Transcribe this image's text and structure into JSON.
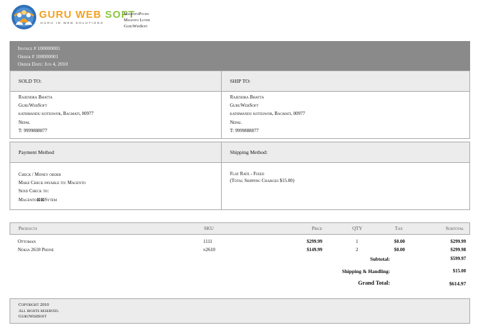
{
  "header": {
    "brand_part1": "GURU WEB",
    "brand_part2": " SOFT",
    "tagline": "GURU IN WEB SOLUTIONS",
    "store_lines": [
      "MagentoPycho",
      "Magento Lover",
      "GuruWebSoft"
    ]
  },
  "order": {
    "invoice": "Invoice # 100000001",
    "order": "Order # 100000001",
    "date": "Order Date: Jun 4, 2010"
  },
  "sold_to": {
    "heading": "SOLD TO:",
    "lines": [
      "Rajendra Bhatta",
      "GuruWebSoft",
      "kathmandu koteswor, Bagmati, 00977",
      "Nepal",
      "T: 9999888877"
    ]
  },
  "ship_to": {
    "heading": "SHIP TO:",
    "lines": [
      "Rajendra Bhatta",
      "GuruWebSoft",
      "kathmandu koteswor, Bagmati, 00977",
      "Nepal",
      "T: 9999888877"
    ]
  },
  "payment": {
    "heading": "Payment Method",
    "lines": [
      "Check / Money order",
      "Make Check payable to: Magento",
      "Send Check to:",
      "Magento⊠⊠Sytem"
    ]
  },
  "shipping": {
    "heading": "Shipping Method:",
    "lines": [
      "Flat Rate - Fixed",
      "(Total Shipping Charges $15.00)"
    ]
  },
  "products": {
    "columns": [
      "Products",
      "SKU",
      "Price",
      "QTY",
      "Tax",
      "Subtotal"
    ],
    "rows": [
      {
        "name": "Ottoman",
        "sku": "1111",
        "price": "$299.99",
        "qty": "1",
        "tax": "$0.00",
        "subtotal": "$299.99"
      },
      {
        "name": "Nokia 2610 Phone",
        "sku": "n2610",
        "price": "$149.99",
        "qty": "2",
        "tax": "$0.00",
        "subtotal": "$299.98"
      }
    ]
  },
  "totals": {
    "subtotal_label": "Subtotal:",
    "subtotal_value": "$599.97",
    "shipping_label": "Shipping & Handling:",
    "shipping_value": "$15.00",
    "grand_label": "Grand Total:",
    "grand_value": "$614.97"
  },
  "footer": {
    "lines": [
      "Copyright 2010",
      "All rights reserved.",
      "GuruWebSoft"
    ]
  }
}
